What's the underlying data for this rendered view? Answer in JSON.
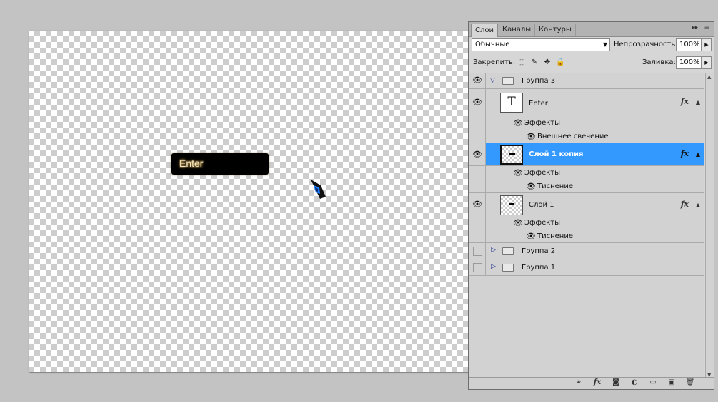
{
  "canvas": {
    "button_text": "Enter"
  },
  "panel": {
    "tabs": [
      "Слои",
      "Каналы",
      "Контуры"
    ],
    "collapse_icon": "▸▸",
    "menu_icon": "≡",
    "blend_mode": "Обычные",
    "opacity_label": "Непрозрачность:",
    "opacity_value": "100%",
    "lock_label": "Закрепить:",
    "fill_label": "Заливка:",
    "fill_value": "100%"
  },
  "layers": [
    {
      "type": "group",
      "name": "Группа 3",
      "visible": true,
      "expanded": true
    },
    {
      "type": "text",
      "name": "Enter",
      "visible": true,
      "fx": true
    },
    {
      "type": "effects",
      "label": "Эффекты"
    },
    {
      "type": "effect",
      "label": "Внешнее свечение"
    },
    {
      "type": "layer",
      "name": "Слой 1 копия",
      "visible": true,
      "fx": true,
      "selected": true
    },
    {
      "type": "effects",
      "label": "Эффекты"
    },
    {
      "type": "effect",
      "label": "Тиснение"
    },
    {
      "type": "layer",
      "name": "Слой 1",
      "visible": true,
      "fx": true
    },
    {
      "type": "effects",
      "label": "Эффекты"
    },
    {
      "type": "effect",
      "label": "Тиснение"
    },
    {
      "type": "group",
      "name": "Группа 2",
      "visible": false,
      "expanded": false
    },
    {
      "type": "group",
      "name": "Группа 1",
      "visible": false,
      "expanded": false
    }
  ],
  "colors": {
    "selection": "#3399ff",
    "canvas_bg": "#c3c3c3"
  },
  "bottom_icons": [
    "link-icon",
    "fx-icon",
    "mask-icon",
    "adjustment-icon",
    "new-group-icon",
    "new-layer-icon",
    "trash-icon"
  ]
}
